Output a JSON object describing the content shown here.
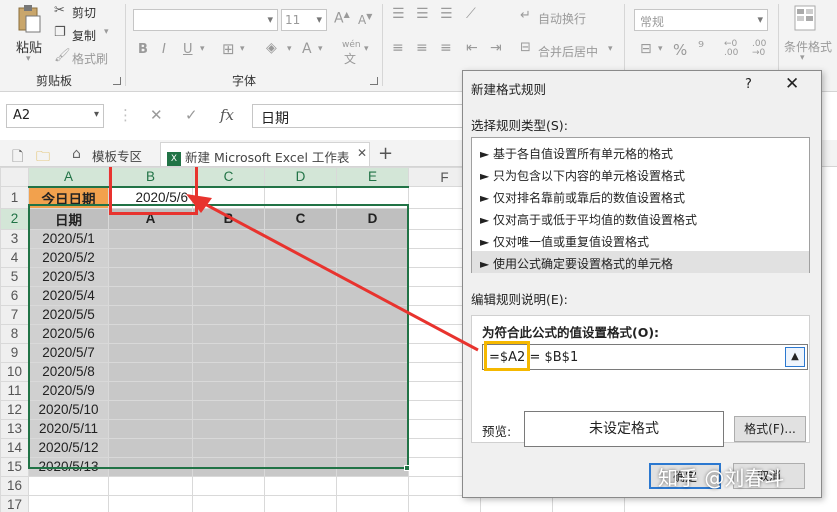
{
  "ribbon": {
    "clipboard": {
      "paste": "粘贴",
      "cut": "剪切",
      "copy": "复制",
      "format_painter": "格式刷",
      "group_label": "剪贴板"
    },
    "font": {
      "font_size": "11",
      "bold": "B",
      "italic": "I",
      "underline": "U",
      "font_color": "A",
      "wen": "wén",
      "group_label": "字体"
    },
    "alignment": {
      "wrap_text": "自动换行",
      "merge_center": "合并后居中"
    },
    "number": {
      "format": "常规",
      "percent": "%"
    },
    "styles": {
      "conditional_format": "条件格式"
    }
  },
  "formula_bar": {
    "name_box": "A2",
    "cancel_icon": "✕",
    "enter_icon": "✓",
    "fx": "fx",
    "value": "日期"
  },
  "tabs": {
    "template": "模板专区",
    "workbook": "新建 Microsoft Excel 工作表",
    "new_tab": "+"
  },
  "sheet": {
    "columns": [
      "A",
      "B",
      "C",
      "D",
      "E",
      "F"
    ],
    "rows": [
      "1",
      "2",
      "3",
      "4",
      "5",
      "6",
      "7",
      "8",
      "9",
      "10",
      "11",
      "12",
      "13",
      "14",
      "15",
      "16",
      "17"
    ],
    "a1": "今日日期",
    "b1": "2020/5/6",
    "header_row": [
      "日期",
      "A",
      "B",
      "C",
      "D"
    ],
    "dates": [
      "2020/5/1",
      "2020/5/2",
      "2020/5/3",
      "2020/5/4",
      "2020/5/5",
      "2020/5/6",
      "2020/5/7",
      "2020/5/8",
      "2020/5/9",
      "2020/5/10",
      "2020/5/11",
      "2020/5/12",
      "2020/5/13"
    ]
  },
  "dialog": {
    "title": "新建格式规则",
    "help": "?",
    "close": "✕",
    "select_rule_type": "选择规则类型(S):",
    "rule_types": [
      "► 基于各自值设置所有单元格的格式",
      "► 只为包含以下内容的单元格设置格式",
      "► 仅对排名靠前或靠后的数值设置格式",
      "► 仅对高于或低于平均值的数值设置格式",
      "► 仅对唯一值或重复值设置格式",
      "► 使用公式确定要设置格式的单元格"
    ],
    "edit_rule_desc": "编辑规则说明(E):",
    "formula_label": "为符合此公式的值设置格式(O):",
    "formula": "=$A2 = $B$1",
    "preview_label": "预览:",
    "preview_text": "未设定格式",
    "format_button": "格式(F)...",
    "ok_button": "确定",
    "cancel_button": "取消"
  },
  "watermark": "知乎 @刘春斗",
  "colors": {
    "excel_green": "#217346",
    "annotation_red": "#e8332e",
    "annotation_yellow": "#f5b800",
    "today_orange": "#f2a14d"
  }
}
